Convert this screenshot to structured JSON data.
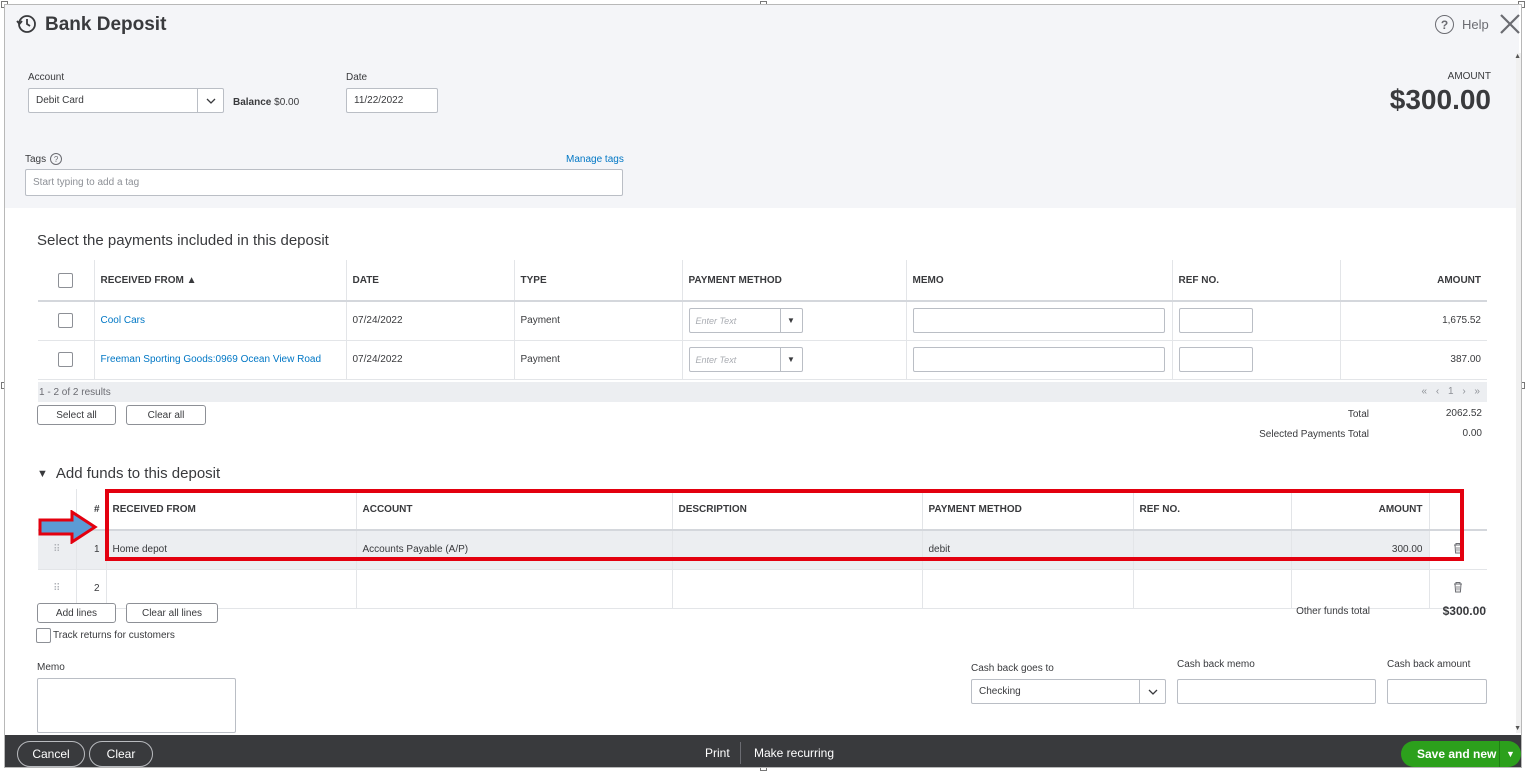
{
  "dialog": {
    "title": "Bank Deposit",
    "help_label": "Help"
  },
  "header": {
    "account_label": "Account",
    "account_value": "Debit Card",
    "balance_label": "Balance",
    "balance_value": "$0.00",
    "date_label": "Date",
    "date_value": "11/22/2022",
    "amount_label": "AMOUNT",
    "amount_value": "$300.00",
    "tags_label": "Tags",
    "manage_tags": "Manage tags",
    "tags_placeholder": "Start typing to add a tag"
  },
  "payments": {
    "title": "Select the payments included in this deposit",
    "columns": [
      "RECEIVED FROM ▲",
      "DATE",
      "TYPE",
      "PAYMENT METHOD",
      "MEMO",
      "REF NO.",
      "AMOUNT"
    ],
    "rows": [
      {
        "received_from": "Cool Cars",
        "date": "07/24/2022",
        "type": "Payment",
        "method_placeholder": "Enter Text",
        "amount": "1,675.52"
      },
      {
        "received_from": "Freeman Sporting Goods:0969 Ocean View Road",
        "date": "07/24/2022",
        "type": "Payment",
        "method_placeholder": "Enter Text",
        "amount": "387.00"
      }
    ],
    "results": "1 - 2 of 2 results",
    "pager": "« ‹ 1 › »",
    "select_all": "Select all",
    "clear_all": "Clear all",
    "total_label": "Total",
    "total_value": "2062.52",
    "selected_label": "Selected Payments Total",
    "selected_value": "0.00"
  },
  "funds": {
    "title": "Add funds to this deposit",
    "columns": [
      "#",
      "RECEIVED FROM",
      "ACCOUNT",
      "DESCRIPTION",
      "PAYMENT METHOD",
      "REF NO.",
      "AMOUNT"
    ],
    "rows": [
      {
        "num": "1",
        "received_from": "Home depot",
        "account": "Accounts Payable (A/P)",
        "description": "",
        "method": "debit",
        "ref": "",
        "amount": "300.00"
      },
      {
        "num": "2",
        "received_from": "",
        "account": "",
        "description": "",
        "method": "",
        "ref": "",
        "amount": ""
      }
    ],
    "add_lines": "Add lines",
    "clear_all_lines": "Clear all lines",
    "other_total_label": "Other funds total",
    "other_total_value": "$300.00",
    "track_returns": "Track returns for customers"
  },
  "bottom": {
    "memo_label": "Memo",
    "cashback_goes_label": "Cash back goes to",
    "cashback_goes_value": "Checking",
    "cashback_memo_label": "Cash back memo",
    "cashback_amount_label": "Cash back amount"
  },
  "footer": {
    "cancel": "Cancel",
    "clear": "Clear",
    "print": "Print",
    "make_recurring": "Make recurring",
    "save_new": "Save and new"
  },
  "colors": {
    "accent_green": "#2ca01c",
    "link_blue": "#0077c5",
    "highlight_red": "#e3000f",
    "footer_bg": "#393a3d"
  }
}
